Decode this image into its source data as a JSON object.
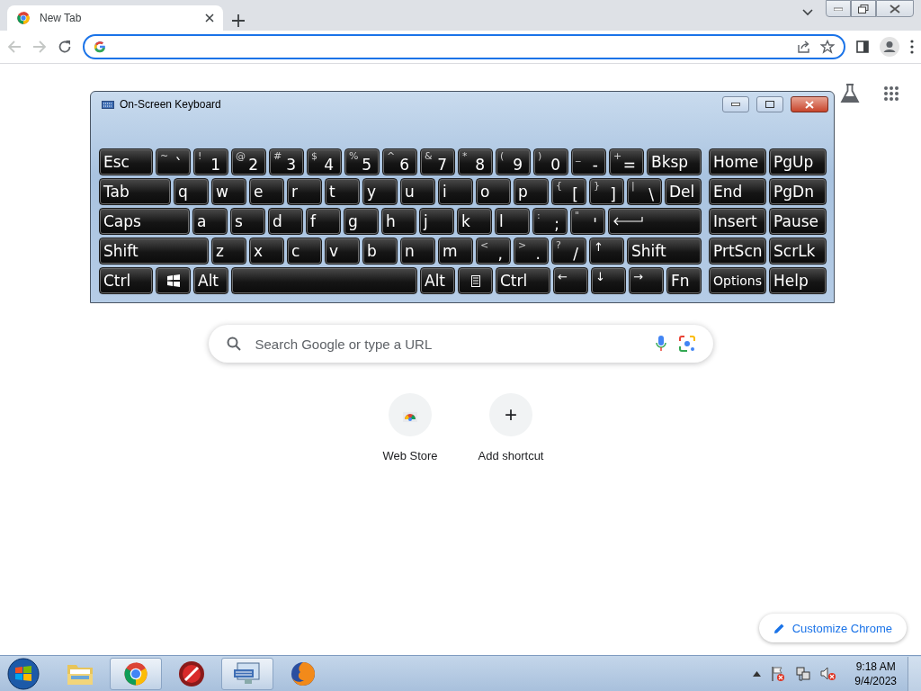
{
  "browser": {
    "tabs": [
      {
        "title": "New Tab",
        "selected": true
      }
    ],
    "search": {
      "placeholder": "Search Google or type a URL"
    },
    "shortcuts": [
      {
        "label": "Web Store",
        "kind": "webstore"
      },
      {
        "label": "Add shortcut",
        "kind": "add",
        "symbol": "+"
      }
    ],
    "customize_button": "Customize Chrome"
  },
  "keyboard": {
    "title": "On-Screen Keyboard",
    "main_rows": [
      [
        {
          "label": "Esc"
        },
        {
          "shift": "~",
          "label": "`"
        },
        {
          "shift": "!",
          "label": "1"
        },
        {
          "shift": "@",
          "label": "2"
        },
        {
          "shift": "#",
          "label": "3"
        },
        {
          "shift": "$",
          "label": "4"
        },
        {
          "shift": "%",
          "label": "5"
        },
        {
          "shift": "^",
          "label": "6"
        },
        {
          "shift": "&",
          "label": "7"
        },
        {
          "shift": "*",
          "label": "8"
        },
        {
          "shift": "(",
          "label": "9"
        },
        {
          "shift": ")",
          "label": "0"
        },
        {
          "shift": "_",
          "label": "-"
        },
        {
          "shift": "+",
          "label": "="
        },
        {
          "label": "Bksp"
        }
      ],
      [
        {
          "label": "Tab"
        },
        {
          "label": "q"
        },
        {
          "label": "w"
        },
        {
          "label": "e"
        },
        {
          "label": "r"
        },
        {
          "label": "t"
        },
        {
          "label": "y"
        },
        {
          "label": "u"
        },
        {
          "label": "i"
        },
        {
          "label": "o"
        },
        {
          "label": "p"
        },
        {
          "shift": "{",
          "label": "["
        },
        {
          "shift": "}",
          "label": "]"
        },
        {
          "shift": "|",
          "label": "\\"
        },
        {
          "label": "Del"
        }
      ],
      [
        {
          "label": "Caps"
        },
        {
          "label": "a"
        },
        {
          "label": "s"
        },
        {
          "label": "d"
        },
        {
          "label": "f"
        },
        {
          "label": "g"
        },
        {
          "label": "h"
        },
        {
          "label": "j"
        },
        {
          "label": "k"
        },
        {
          "label": "l"
        },
        {
          "shift": ":",
          "label": ";"
        },
        {
          "shift": "\"",
          "label": "'"
        },
        {
          "kind": "enter"
        }
      ],
      [
        {
          "label": "Shift"
        },
        {
          "label": "z"
        },
        {
          "label": "x"
        },
        {
          "label": "c"
        },
        {
          "label": "v"
        },
        {
          "label": "b"
        },
        {
          "label": "n"
        },
        {
          "label": "m"
        },
        {
          "shift": "<",
          "label": ","
        },
        {
          "shift": ">",
          "label": "."
        },
        {
          "shift": "?",
          "label": "/"
        },
        {
          "label": "↑",
          "kind": "arrow"
        },
        {
          "label": "Shift"
        }
      ],
      [
        {
          "label": "Ctrl"
        },
        {
          "kind": "windows"
        },
        {
          "label": "Alt"
        },
        {
          "kind": "space"
        },
        {
          "label": "Alt"
        },
        {
          "kind": "menu"
        },
        {
          "label": "Ctrl"
        },
        {
          "label": "←",
          "kind": "arrow"
        },
        {
          "label": "↓",
          "kind": "arrow"
        },
        {
          "label": "→",
          "kind": "arrow"
        },
        {
          "label": "Fn"
        }
      ]
    ],
    "nav_rows": [
      [
        {
          "label": "Home"
        },
        {
          "label": "PgUp"
        }
      ],
      [
        {
          "label": "End"
        },
        {
          "label": "PgDn"
        }
      ],
      [
        {
          "label": "Insert"
        },
        {
          "label": "Pause"
        }
      ],
      [
        {
          "label": "PrtScn"
        },
        {
          "label": "ScrLk"
        }
      ],
      [
        {
          "label": "Options",
          "kind": "small"
        },
        {
          "label": "Help"
        }
      ]
    ]
  },
  "taskbar": {
    "apps": [
      {
        "kind": "explorer",
        "active": false
      },
      {
        "kind": "chrome",
        "active": true
      },
      {
        "kind": "red",
        "active": false
      },
      {
        "kind": "keyboard",
        "active": true
      },
      {
        "kind": "firefox",
        "active": false
      }
    ],
    "time": "9:18 AM",
    "date": "9/4/2023"
  }
}
